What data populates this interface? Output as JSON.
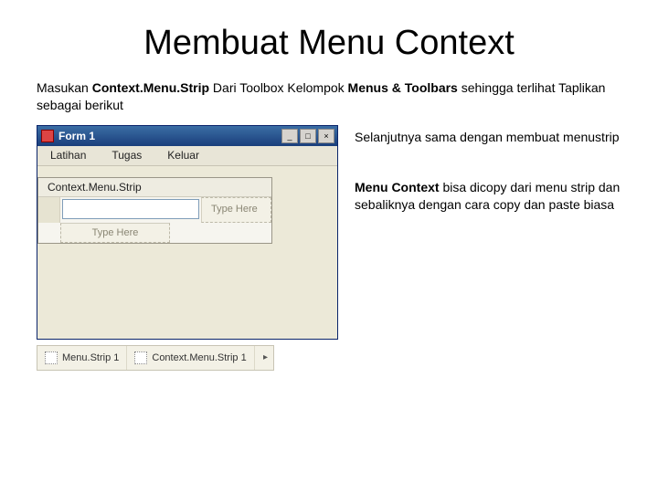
{
  "title": "Membuat Menu Context",
  "intro": {
    "prefix": "Masukan ",
    "bold1": "Context.Menu.Strip",
    "mid1": " Dari Toolbox Kelompok ",
    "bold2": "Menus & Toolbars",
    "suffix": " sehingga terlihat Taplikan sebagai berikut"
  },
  "window": {
    "title": "Form 1",
    "buttons": {
      "min": "_",
      "max": "□",
      "close": "×"
    },
    "menubar": [
      "Latihan",
      "Tugas",
      "Keluar"
    ]
  },
  "contextmenu": {
    "header": "Context.Menu.Strip",
    "type_here": "Type Here"
  },
  "tray": {
    "items": [
      "Menu.Strip 1",
      "Context.Menu.Strip 1"
    ],
    "arrow": "▸"
  },
  "right": {
    "p1": "Selanjutnya sama dengan membuat menustrip",
    "p2_bold": "Menu Context",
    "p2_rest": " bisa dicopy dari menu strip dan sebaliknya dengan cara copy dan paste biasa"
  }
}
